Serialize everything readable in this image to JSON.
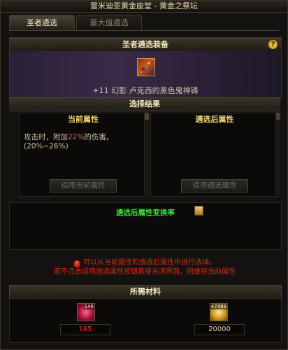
{
  "window": {
    "title": "雷米迪亚黄金座堂 - 黄金之祭坛"
  },
  "tabs": [
    {
      "label": "圣者遴选",
      "active": true
    },
    {
      "label": "最大值遴选",
      "active": false
    }
  ],
  "equip": {
    "header": "圣者遴选装备",
    "help_label": "?",
    "item_name": "+11 幻影  卢克西的黑色鬼神铸",
    "item_icon": "dark-ghost-weapon-icon"
  },
  "results": {
    "header": "选择结果",
    "current": {
      "title": "当前属性",
      "text_before": "攻击时，附加",
      "highlight": "22%",
      "text_after": "的伤害。(20%~26%)",
      "button_label": "适用当前属性"
    },
    "after": {
      "title": "遴选后属性",
      "text": "",
      "button_label": "适用遴选属性"
    }
  },
  "rate": {
    "label": "遴选后属性变换率"
  },
  "warning": {
    "line1": "可以从当前属性和遴选后属性中进行选择。",
    "line2": "若不点击适用遴选属性按钮直接关闭界面，则维持当前属性"
  },
  "materials": {
    "header": "所需材料",
    "items": [
      {
        "icon": "red-orb-material-icon",
        "stack": "146",
        "required": "165",
        "color": "#e0402a"
      },
      {
        "icon": "gold-coin-icon",
        "stack": "47488",
        "required": "20000",
        "color": "#d8d0b8"
      }
    ]
  }
}
